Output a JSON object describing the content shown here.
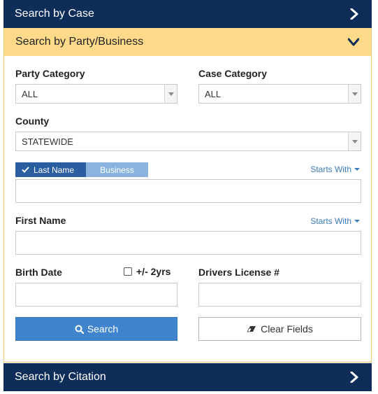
{
  "accordion": {
    "case": {
      "label": "Search by Case"
    },
    "party": {
      "label": "Search by Party/Business"
    },
    "citation": {
      "label": "Search by Citation"
    }
  },
  "form": {
    "party_category": {
      "label": "Party Category",
      "value": "ALL"
    },
    "case_category": {
      "label": "Case Category",
      "value": "ALL"
    },
    "county": {
      "label": "County",
      "value": "STATEWIDE"
    },
    "name_toggle": {
      "last_name": "Last Name",
      "business": "Business"
    },
    "starts_with_last": "Starts With",
    "first_name": {
      "label": "First Name",
      "starts_with": "Starts With"
    },
    "birth_date": {
      "label": "Birth Date",
      "range_label": "+/- 2yrs"
    },
    "drivers_license": {
      "label": "Drivers License #"
    },
    "search_button": "Search",
    "clear_button": "Clear Fields"
  },
  "colors": {
    "header_dark": "#0e2d59",
    "header_active": "#fdd98a",
    "primary": "#3f84cc",
    "toggle_on": "#2b5ea1",
    "toggle_off": "#8ab4df",
    "link": "#3b79b8"
  }
}
